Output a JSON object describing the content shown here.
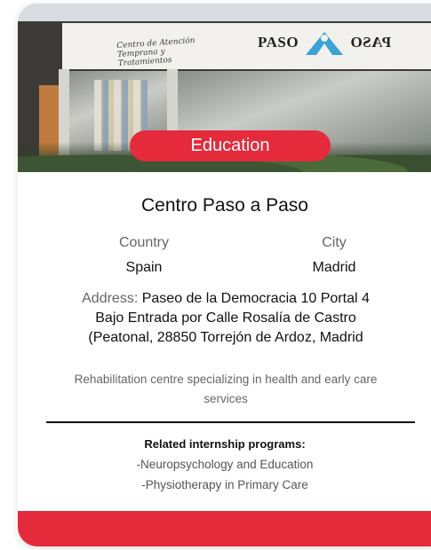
{
  "card": {
    "category_badge": "Education",
    "title": "Centro Paso a Paso",
    "country_label": "Country",
    "country_value": "Spain",
    "city_label": "City",
    "city_value": "Madrid",
    "address_label": "Address:",
    "address_value": "Paseo de la Democracia 10 Portal 4 Bajo Entrada por Calle Rosalía de Castro (Peatonal, 28850 Torrejón de Ardoz, Madrid",
    "description": "Rehabilitation centre specializing in health and early care services",
    "related_title": "Related internship programs:",
    "programs": [
      "-Neuropsychology and Education",
      "-Physiotherapy in Primary Care"
    ]
  },
  "photo": {
    "sign_text": "Centro de Atención Temprana y Tratamientos",
    "logo_left": "PASO",
    "logo_right": "PASO",
    "logo_icon": "paso-a-paso-logo-icon"
  },
  "colors": {
    "accent": "#e52a3c",
    "muted_text": "#666666"
  }
}
